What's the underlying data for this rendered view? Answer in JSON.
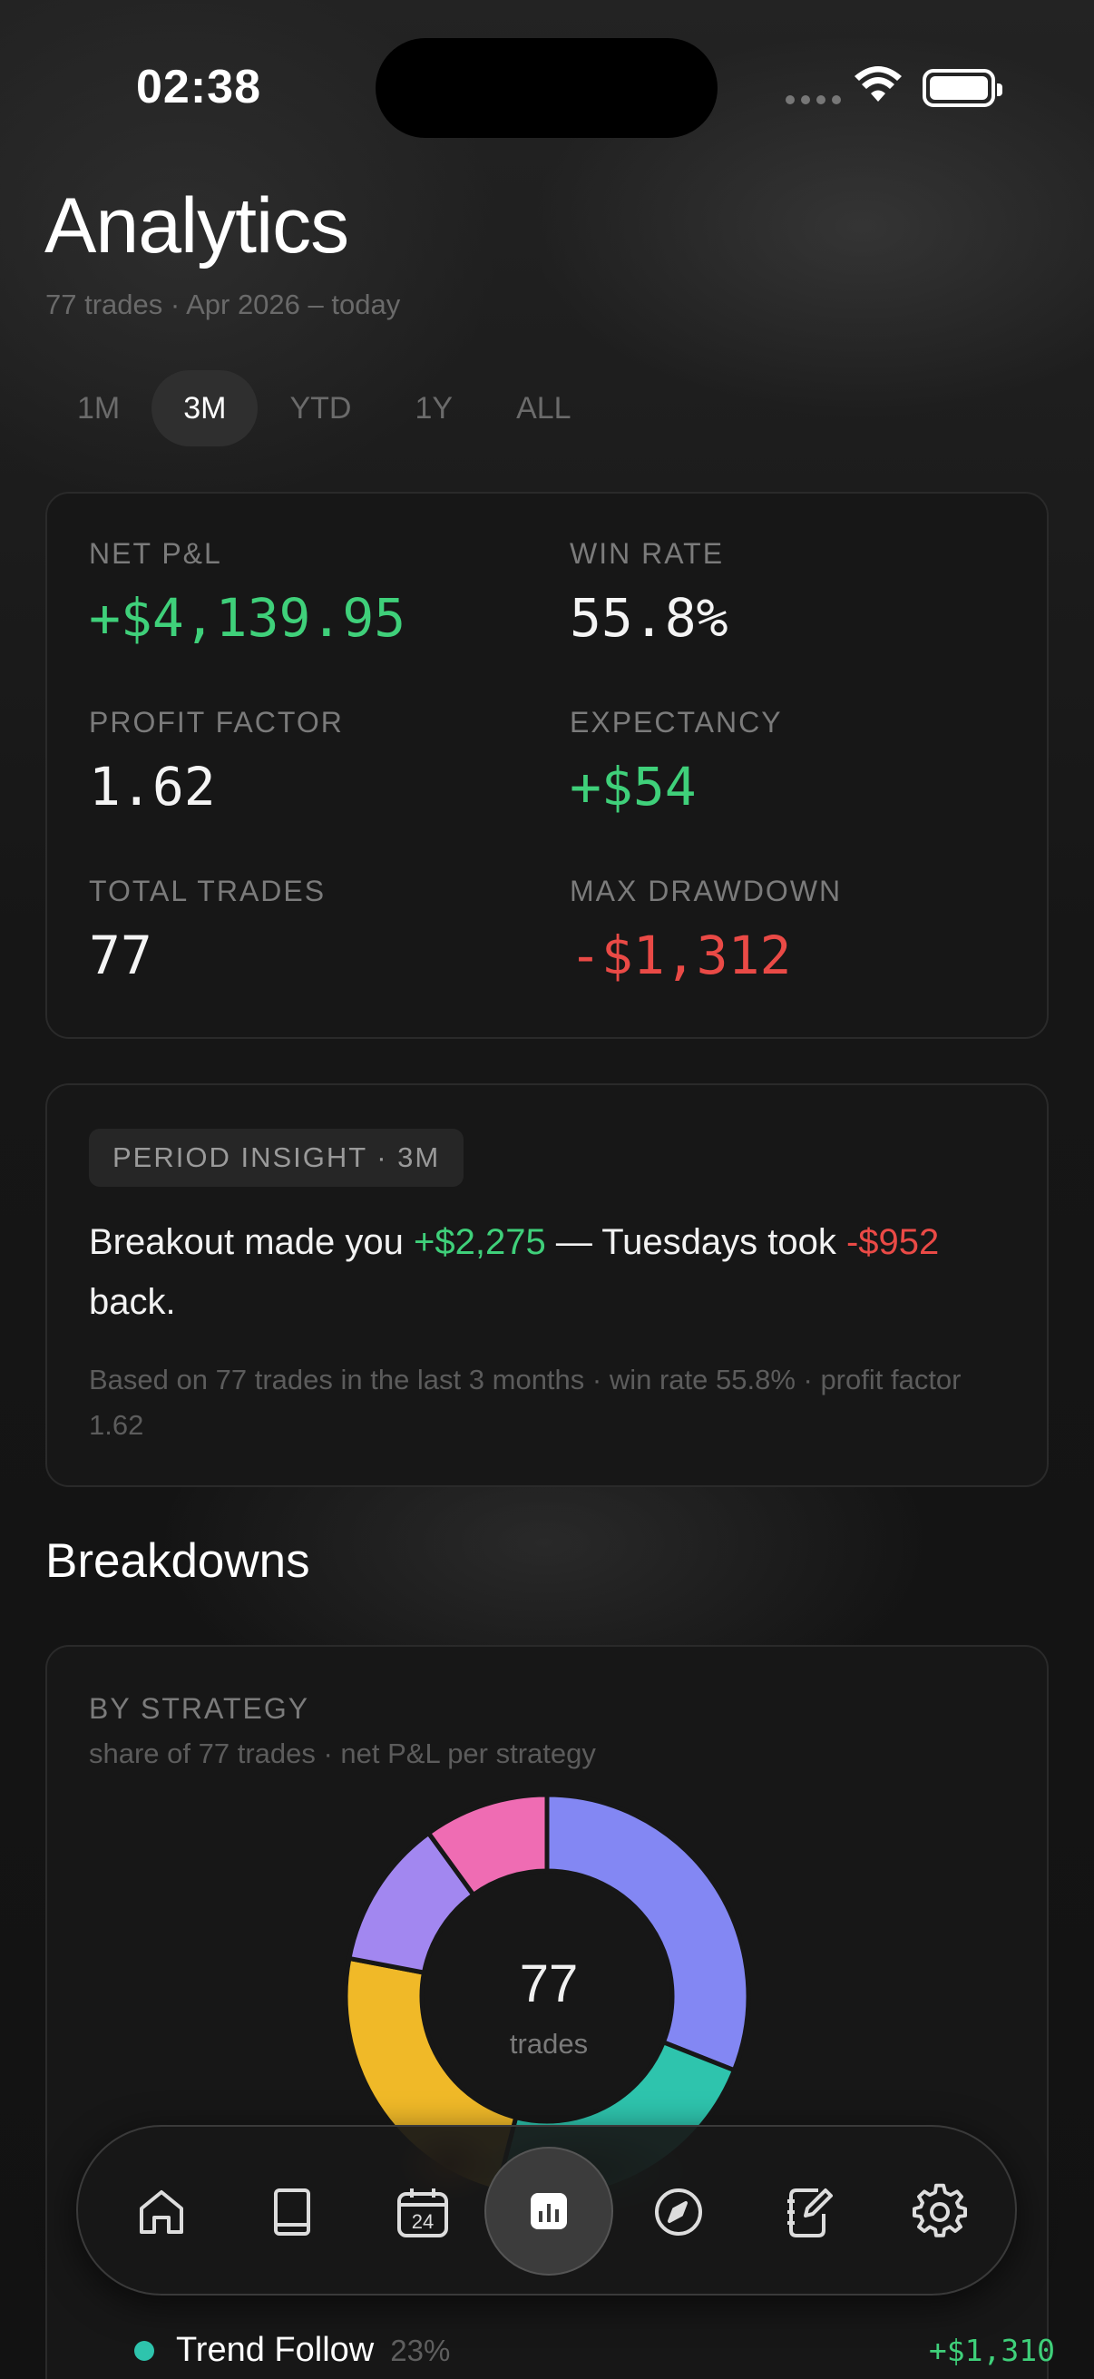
{
  "status_bar": {
    "time": "02:38"
  },
  "header": {
    "title": "Analytics",
    "subtitle": "77 trades · Apr 2026 – today"
  },
  "periods": [
    {
      "label": "1M",
      "active": false
    },
    {
      "label": "3M",
      "active": true
    },
    {
      "label": "YTD",
      "active": false
    },
    {
      "label": "1Y",
      "active": false
    },
    {
      "label": "ALL",
      "active": false
    }
  ],
  "stats": {
    "net_pl": {
      "label": "NET P&L",
      "value": "+$4,139.95"
    },
    "win_rate": {
      "label": "WIN RATE",
      "value": "55.8%"
    },
    "profit_factor": {
      "label": "PROFIT FACTOR",
      "value": "1.62"
    },
    "expectancy": {
      "label": "EXPECTANCY",
      "value": "+$54"
    },
    "total_trades": {
      "label": "TOTAL TRADES",
      "value": "77"
    },
    "max_drawdown": {
      "label": "MAX DRAWDOWN",
      "value": "-$1,312"
    }
  },
  "insight": {
    "pill": "PERIOD INSIGHT · 3M",
    "part1": "Breakout made you ",
    "gain": "+$2,275",
    "part2": " — Tuesdays took ",
    "loss": "-$952",
    "part3": " back.",
    "note": "Based on 77 trades in the last 3 months · win rate 55.8% · profit factor 1.62"
  },
  "breakdowns": {
    "section_title": "Breakdowns",
    "by_strategy": {
      "label": "BY STRATEGY",
      "subtitle": "share of 77 trades · net P&L per strategy",
      "center_value": "77",
      "center_label": "trades",
      "rows": [
        {
          "name": "Trend Follow",
          "pct": "23%",
          "amount": "+$1,310",
          "color": "#2ec4ad"
        }
      ]
    }
  },
  "chart_data": {
    "type": "pie",
    "colors": [
      "#8387f3",
      "#2ec4ad",
      "#f0b928",
      "#a287f0",
      "#ef6cb3"
    ],
    "values": [
      31,
      23,
      24,
      12,
      10
    ]
  },
  "tabbar": {
    "items": [
      {
        "icon": "home-icon"
      },
      {
        "icon": "book-icon"
      },
      {
        "icon": "calendar-icon",
        "badge": "24"
      },
      {
        "icon": "chart-icon",
        "active": true
      },
      {
        "icon": "compass-icon"
      },
      {
        "icon": "notebook-edit-icon"
      },
      {
        "icon": "gear-icon"
      }
    ]
  }
}
